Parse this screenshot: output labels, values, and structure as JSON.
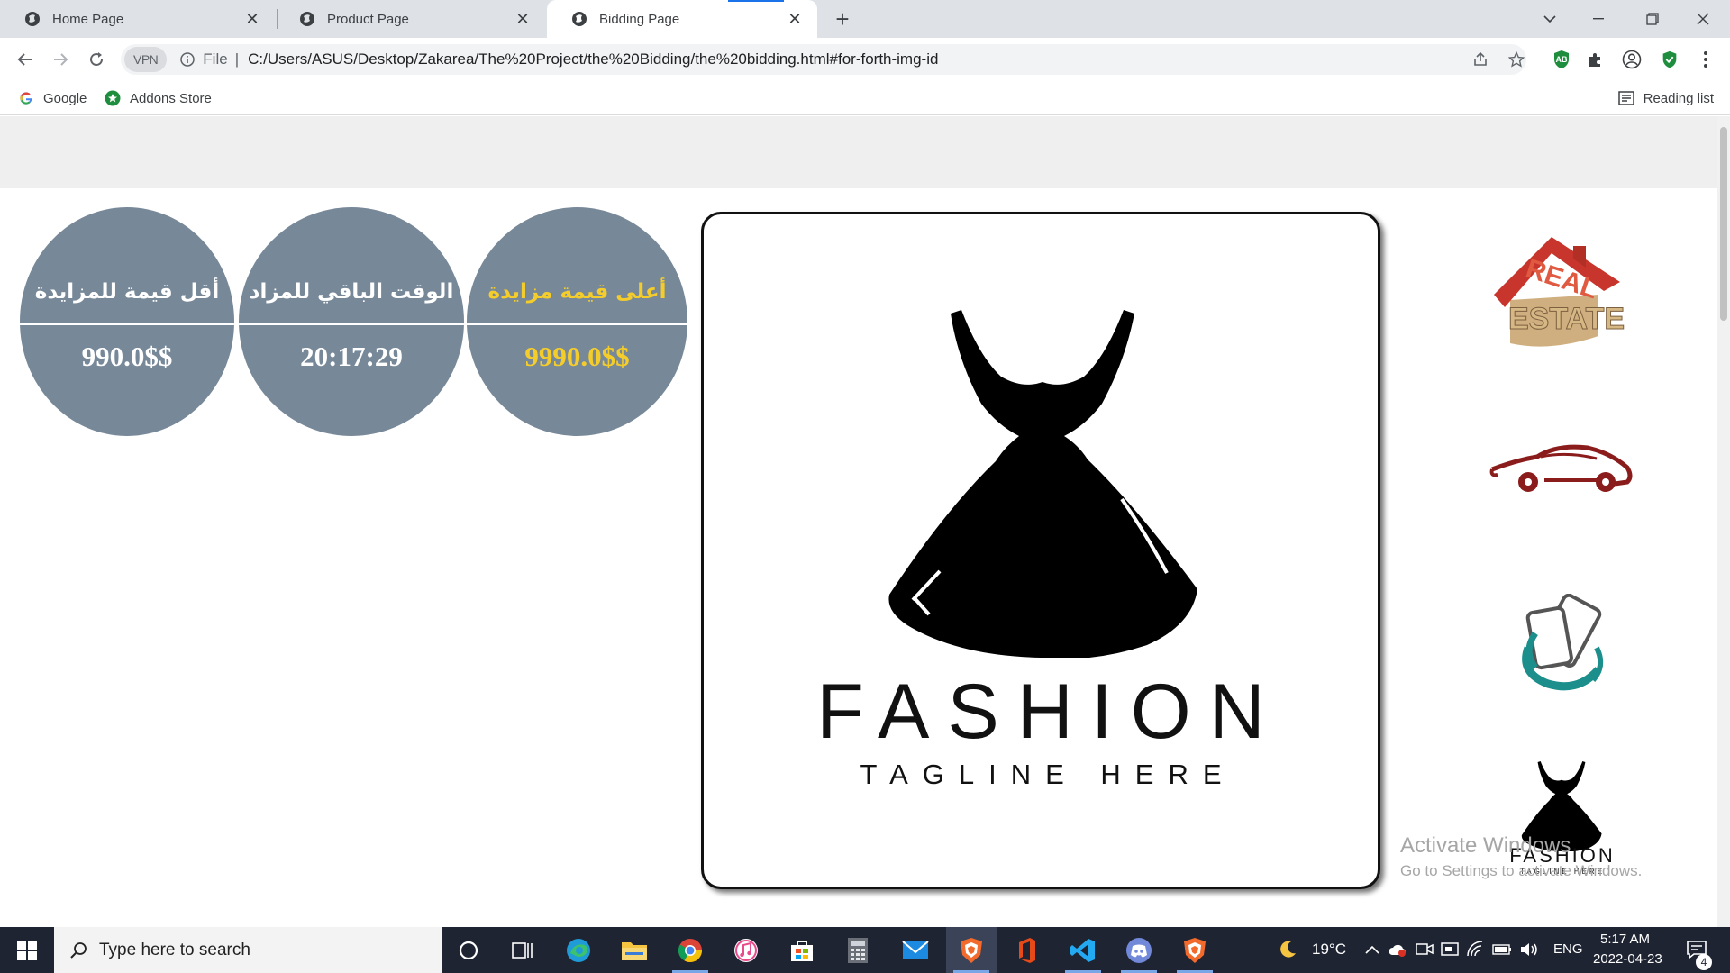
{
  "browser": {
    "tabs": [
      {
        "label": "Home Page",
        "active": false
      },
      {
        "label": "Product Page",
        "active": false
      },
      {
        "label": "Bidding Page",
        "active": true
      }
    ],
    "new_tab_label": "+",
    "close_glyph": "✕",
    "address": {
      "vpn_label": "VPN",
      "file_label": "File",
      "separator": "|",
      "url": "C:/Users/ASUS/Desktop/Zakarea/The%20Project/the%20Bidding/the%20bidding.html#for-forth-img-id"
    },
    "bookmarks": [
      {
        "label": "Google",
        "icon": "google-icon"
      },
      {
        "label": "Addons Store",
        "icon": "addons-store-icon"
      }
    ],
    "reading_list_label": "Reading list",
    "extension_ab_label": "AB"
  },
  "page": {
    "stats": [
      {
        "title": "أعلى قيمة مزايدة",
        "value": "9990.0$$",
        "color": "#f5cd2b"
      },
      {
        "title": "الوقت الباقي للمزاد",
        "value": "20:17:29",
        "color": "#ffffff"
      },
      {
        "title": "أقل قيمة للمزايدة",
        "value": "990.0$$",
        "color": "#ffffff"
      }
    ],
    "main_image": {
      "brand": "FASHION",
      "tagline": "TAGLINE HERE"
    },
    "thumbnails": [
      {
        "name": "real-estate",
        "line1": "REAL",
        "line2": "ESTATE"
      },
      {
        "name": "car"
      },
      {
        "name": "phones"
      },
      {
        "name": "fashion",
        "brand": "FASHION",
        "tagline": "TAGLINE HERE"
      }
    ],
    "watermark": {
      "line1": "Activate Windows",
      "line2": "Go to Settings to activate Windows."
    },
    "circle_color": "#778899"
  },
  "taskbar": {
    "search_placeholder": "Type here to search",
    "weather": "19°C",
    "language": "ENG",
    "time": "5:17 AM",
    "date": "2022-04-23",
    "notification_count": "4"
  }
}
